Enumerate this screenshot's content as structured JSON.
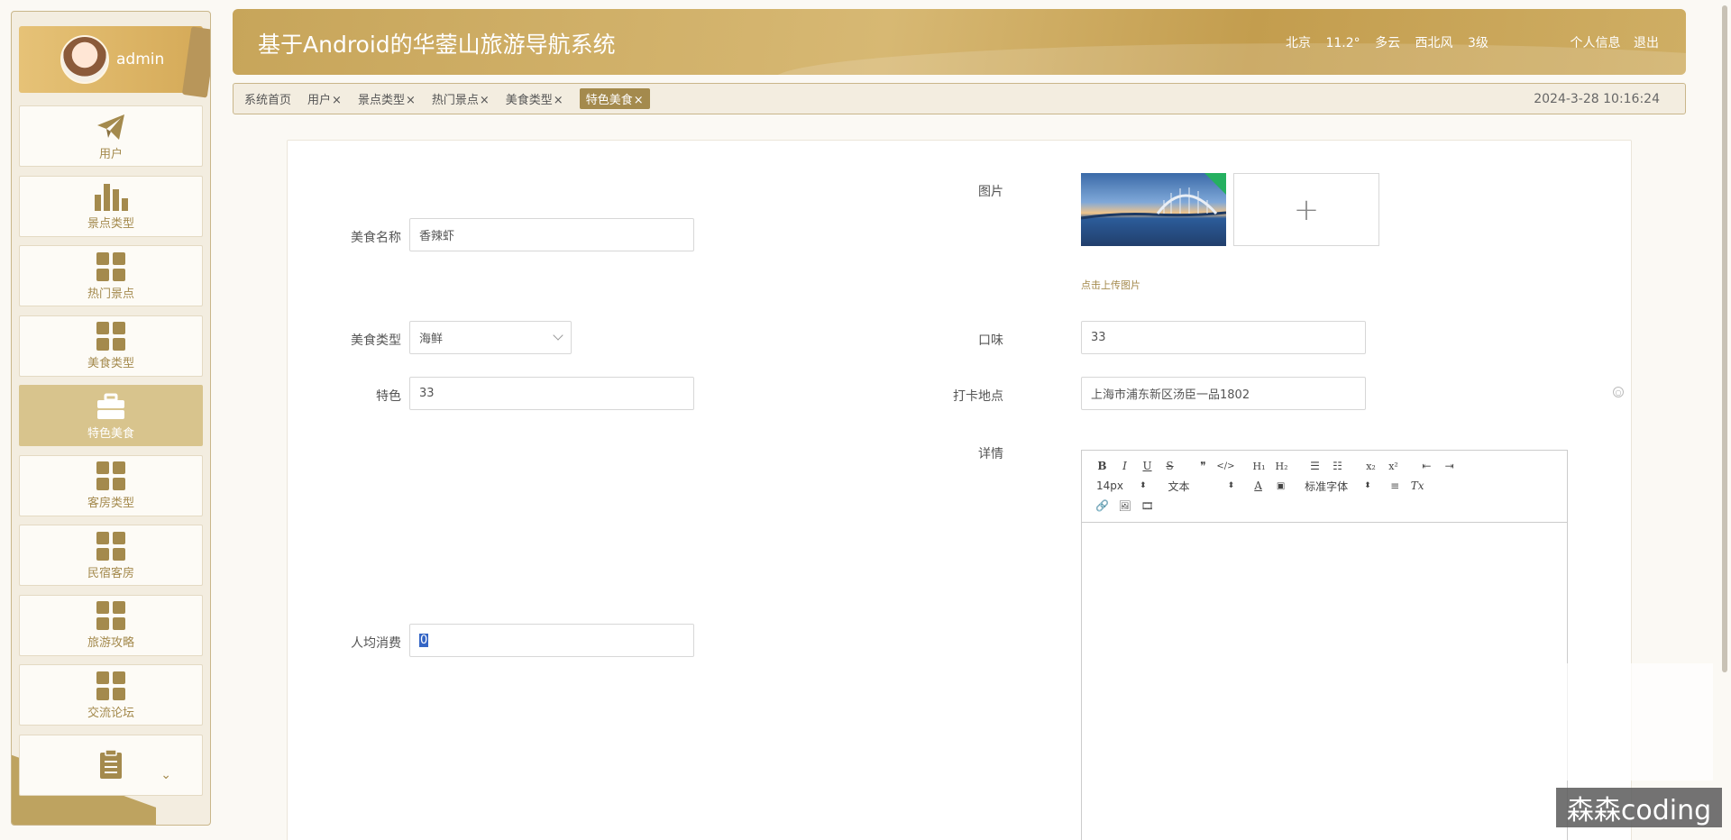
{
  "user": {
    "name": "admin"
  },
  "sidebar": {
    "items": [
      {
        "label": "用户",
        "icon": "paper-plane-icon"
      },
      {
        "label": "景点类型",
        "icon": "bar-chart-icon"
      },
      {
        "label": "热门景点",
        "icon": "grid-icon"
      },
      {
        "label": "美食类型",
        "icon": "grid-icon"
      },
      {
        "label": "特色美食",
        "icon": "briefcase-icon",
        "active": true
      },
      {
        "label": "客房类型",
        "icon": "grid-icon"
      },
      {
        "label": "民宿客房",
        "icon": "grid-icon"
      },
      {
        "label": "旅游攻略",
        "icon": "grid-icon"
      },
      {
        "label": "交流论坛",
        "icon": "grid-icon"
      },
      {
        "label": "",
        "icon": "clipboard-icon"
      }
    ]
  },
  "header": {
    "title": "基于Android的华蓥山旅游导航系统",
    "weather": {
      "city": "北京",
      "temp": "11.2°",
      "condition": "多云",
      "wind": "西北风",
      "level": "3级"
    },
    "links": {
      "profile": "个人信息",
      "logout": "退出"
    }
  },
  "tabs": {
    "items": [
      {
        "label": "系统首页",
        "closable": false
      },
      {
        "label": "用户",
        "closable": true
      },
      {
        "label": "景点类型",
        "closable": true
      },
      {
        "label": "热门景点",
        "closable": true
      },
      {
        "label": "美食类型",
        "closable": true
      },
      {
        "label": "特色美食",
        "closable": true,
        "active": true
      }
    ],
    "close_glyph": "×",
    "datetime": "2024-3-28 10:16:24"
  },
  "form": {
    "name": {
      "label": "美食名称",
      "value": "香辣虾"
    },
    "image": {
      "label": "图片",
      "upload_hint": "点击上传图片",
      "add_glyph": "+"
    },
    "type": {
      "label": "美食类型",
      "value": "海鲜"
    },
    "taste": {
      "label": "口味",
      "value": "33"
    },
    "feature": {
      "label": "特色",
      "value": "33"
    },
    "location": {
      "label": "打卡地点",
      "value": "上海市浦东新区汤臣一品1802"
    },
    "detail": {
      "label": "详情"
    },
    "avg_cost": {
      "label": "人均消费",
      "value": "0"
    }
  },
  "editor": {
    "font_size": "14px",
    "paragraph": "文本",
    "font_family": "标准字体"
  },
  "watermark": "森森coding",
  "colors": {
    "accent": "#a48a4d",
    "header": "#c7a55a",
    "active_menu": "#d8c48d"
  }
}
